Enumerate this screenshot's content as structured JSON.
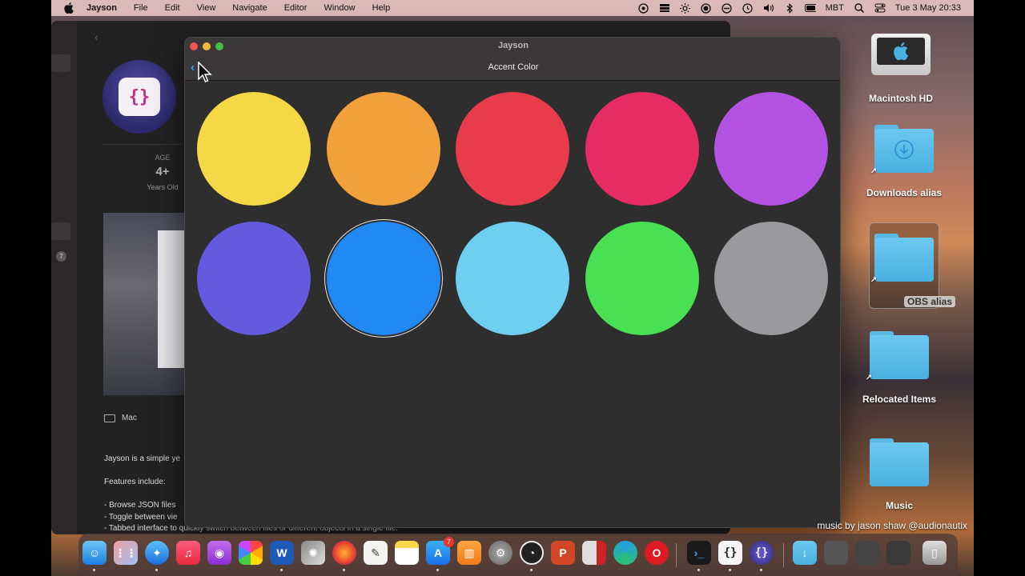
{
  "menubar": {
    "app_name": "Jayson",
    "menus": [
      "File",
      "Edit",
      "View",
      "Navigate",
      "Editor",
      "Window",
      "Help"
    ],
    "status_icons": [
      "obs-icon",
      "stack-icon",
      "brightness-icon",
      "record-icon",
      "focus-icon",
      "time-machine-icon",
      "volume-icon",
      "bluetooth-icon",
      "battery-icon"
    ],
    "timezone": "MBT",
    "datetime": "Tue 3 May  20:33"
  },
  "background_window": {
    "age_label": "AGE",
    "age_value": "4+",
    "age_sub": "Years Old",
    "sidebar_badge": "7",
    "platform": "Mac",
    "description": "Jayson is a simple ye\n\nFeatures include:\n\n- Browse JSON files\n- Toggle between vie\n- Tabbed interface to quickly switch between files or different objects in a single file."
  },
  "jayson_window": {
    "title": "Jayson",
    "subtitle": "Accent Color",
    "back_glyph": "‹",
    "colors": [
      {
        "name": "yellow",
        "hex": "#f5d845",
        "selected": false
      },
      {
        "name": "orange",
        "hex": "#f1a03a",
        "selected": false
      },
      {
        "name": "red",
        "hex": "#e83b4b",
        "selected": false
      },
      {
        "name": "pink",
        "hex": "#e72c65",
        "selected": false
      },
      {
        "name": "purple",
        "hex": "#b452e4",
        "selected": false
      },
      {
        "name": "indigo",
        "hex": "#635ae0",
        "selected": false
      },
      {
        "name": "blue",
        "hex": "#2089f4",
        "selected": true
      },
      {
        "name": "cyan",
        "hex": "#6dd0f0",
        "selected": false
      },
      {
        "name": "green",
        "hex": "#49e054",
        "selected": false
      },
      {
        "name": "gray",
        "hex": "#9a999e",
        "selected": false
      }
    ]
  },
  "desktop": {
    "icons": [
      {
        "label": "Macintosh HD",
        "kind": "hdd"
      },
      {
        "label": "Downloads alias",
        "kind": "folder-alias"
      },
      {
        "label": "OBS alias",
        "kind": "folder-alias"
      },
      {
        "label": "Relocated Items",
        "kind": "folder-alias"
      },
      {
        "label": "Music",
        "kind": "folder"
      }
    ],
    "credit": "music by jason shaw @audionautix"
  },
  "dock": {
    "apps": [
      "finder",
      "launchpad",
      "safari",
      "music",
      "podcasts",
      "photos",
      "word",
      "motion",
      "firefox",
      "textedit",
      "notes",
      "app-store",
      "books",
      "system-preferences",
      "obs",
      "powerpoint",
      "parallels",
      "edge",
      "opera",
      "terminal",
      "brackets",
      "jayson",
      "downloads-stack",
      "screenshots-stack",
      "trash"
    ],
    "app_store_badge": "7"
  }
}
